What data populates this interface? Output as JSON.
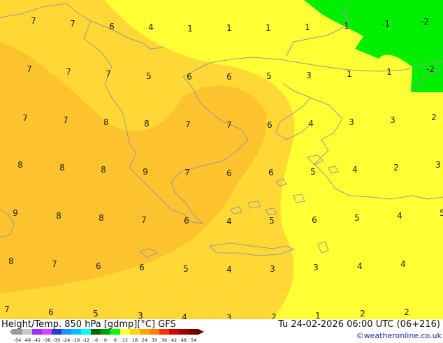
{
  "footer": {
    "title": "Height/Temp. 850 hPa [gdmp][°C] GFS",
    "valid_time": "Tu 24-02-2026 06:00 UTC (06+216)",
    "copyright": "©weatheronline.co.uk",
    "legend_ticks": [
      "-54",
      "-48",
      "-42",
      "-38",
      "-30",
      "-24",
      "-18",
      "-12",
      "-6",
      "0",
      "6",
      "12",
      "18",
      "24",
      "30",
      "36",
      "42",
      "48",
      "54"
    ],
    "legend_colors": [
      "#9a9a9a",
      "#c8c8c8",
      "#9b30ff",
      "#e040fb",
      "#1e3fdc",
      "#1e90ff",
      "#00bfff",
      "#00ffff",
      "#006400",
      "#00a000",
      "#00ff00",
      "#ffff33",
      "#ffd700",
      "#ffa500",
      "#ff7f00",
      "#ff3000",
      "#d00000",
      "#a00000",
      "#700000"
    ]
  },
  "map": {
    "colors": {
      "yellow": "#ffff33",
      "gold": "#ffd835",
      "orange": "#fcc32e",
      "green": "#00ee00",
      "coast": "#9a9a9a"
    },
    "labels": [
      {
        "t": "7"
      },
      {
        "t": "7"
      },
      {
        "t": "6"
      },
      {
        "t": "4"
      },
      {
        "t": "1"
      },
      {
        "t": "1"
      },
      {
        "t": "1"
      },
      {
        "t": "1"
      },
      {
        "t": "1"
      },
      {
        "t": "-1"
      },
      {
        "t": "-2"
      },
      {
        "t": "7"
      },
      {
        "t": "7"
      },
      {
        "t": "7"
      },
      {
        "t": "5"
      },
      {
        "t": "6"
      },
      {
        "t": "6"
      },
      {
        "t": "5"
      },
      {
        "t": "3"
      },
      {
        "t": "1"
      },
      {
        "t": "1"
      },
      {
        "t": "-2"
      },
      {
        "t": "7"
      },
      {
        "t": "7"
      },
      {
        "t": "8"
      },
      {
        "t": "8"
      },
      {
        "t": "7"
      },
      {
        "t": "7"
      },
      {
        "t": "6"
      },
      {
        "t": "4"
      },
      {
        "t": "3"
      },
      {
        "t": "3"
      },
      {
        "t": "2"
      },
      {
        "t": "8"
      },
      {
        "t": "8"
      },
      {
        "t": "8"
      },
      {
        "t": "9"
      },
      {
        "t": "7"
      },
      {
        "t": "6"
      },
      {
        "t": "6"
      },
      {
        "t": "5"
      },
      {
        "t": "4"
      },
      {
        "t": "2"
      },
      {
        "t": "3"
      },
      {
        "t": "9"
      },
      {
        "t": "8"
      },
      {
        "t": "8"
      },
      {
        "t": "7"
      },
      {
        "t": "6"
      },
      {
        "t": "4"
      },
      {
        "t": "5"
      },
      {
        "t": "6"
      },
      {
        "t": "5"
      },
      {
        "t": "4"
      },
      {
        "t": "5"
      },
      {
        "t": "8"
      },
      {
        "t": "7"
      },
      {
        "t": "6"
      },
      {
        "t": "6"
      },
      {
        "t": "5"
      },
      {
        "t": "4"
      },
      {
        "t": "3"
      },
      {
        "t": "3"
      },
      {
        "t": "4"
      },
      {
        "t": "4"
      },
      {
        "t": "7"
      },
      {
        "t": "6"
      },
      {
        "t": "5"
      },
      {
        "t": "3"
      },
      {
        "t": "4"
      },
      {
        "t": "3"
      },
      {
        "t": "2"
      },
      {
        "t": "1"
      },
      {
        "t": "2"
      },
      {
        "t": "2"
      }
    ]
  }
}
